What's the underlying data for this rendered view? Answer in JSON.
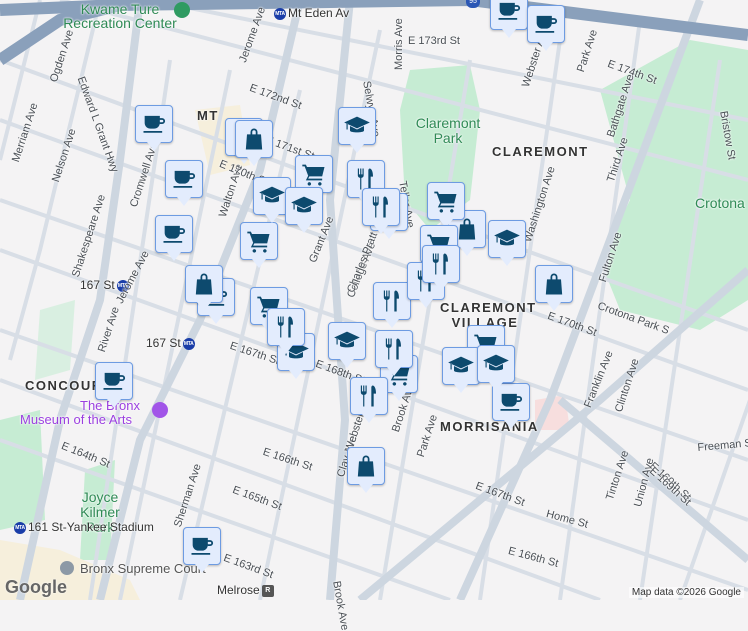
{
  "colors": {
    "background": "#f4f3f4",
    "park": "#c6ecd3",
    "road": "#d5dce4",
    "highway": "#8aa0bb",
    "marker_fill": "#e3ecfd",
    "marker_border": "#6d9be2",
    "icon": "#0d4a6e"
  },
  "neighborhoods": [
    "CLAREMONT",
    "CLAREMONT VILLAGE",
    "MORRISANIA",
    "CONCOURSE",
    "MT"
  ],
  "parks": [
    "Claremont Park",
    "Crotona",
    "Joyce Kilmer Park"
  ],
  "places": {
    "recreation": "Kwame Ture Recreation Center",
    "museum_line1": "The Bronx",
    "museum_line2": "Museum of the Arts",
    "court": "Bronx Supreme Court"
  },
  "transit": [
    "Mt Eden Av",
    "167 St",
    "167 St",
    "161 St-Yankee Stadium",
    "Melrose"
  ],
  "transit_badge": "MTA",
  "highway_shield": "95",
  "streets": [
    "Ogden Ave",
    "Edward L Grant Hwy",
    "Jerome Ave",
    "Merriam Ave",
    "Nelson Ave",
    "Shakespeare Ave",
    "Cromwell Ave",
    "Walton Ave",
    "E 172nd St",
    "E 171st St",
    "E 170th St",
    "Grant Ave",
    "College Ave",
    "Morris Ave",
    "E 173rd St",
    "Webster Ave",
    "Park Ave",
    "E 174th St",
    "Bathgate Ave",
    "Third Ave",
    "Teller Ave",
    "Selwyn Ave",
    "Washington Ave",
    "Fulton Ave",
    "Crotona Park S",
    "E 170th St",
    "Franklin Ave",
    "Clinton Ave",
    "Freeman St",
    "E 169th St",
    "Tinton Ave",
    "Union Ave",
    "Home St",
    "E 167th St",
    "E 166th St",
    "River Ave",
    "E 167th St",
    "E 168th St",
    "E 164th St",
    "Sherman Ave",
    "E 166th St",
    "E 165th St",
    "Clay Ave",
    "Brook Ave",
    "E 163rd St",
    "Jerome Ave",
    "E 169th St",
    "Charles Pratt Way",
    "Webster Ave",
    "Brook Ave",
    "Park Ave",
    "Bristow St"
  ],
  "markers": [
    "coffee",
    "coffee",
    "coffee",
    "coffee",
    "coffee",
    "coffee",
    "coffee",
    "coffee",
    "coffee",
    "coffee",
    "shopping",
    "shopping",
    "shopping",
    "shopping",
    "shopping",
    "shopping",
    "grocery",
    "grocery",
    "grocery",
    "grocery",
    "grocery",
    "grocery",
    "grocery",
    "school",
    "school",
    "school",
    "school",
    "school",
    "school",
    "school",
    "school",
    "dining",
    "dining",
    "dining",
    "dining",
    "dining",
    "dining",
    "dining",
    "dining"
  ],
  "attribution": "Map data ©2026 Google",
  "logo": "Google"
}
